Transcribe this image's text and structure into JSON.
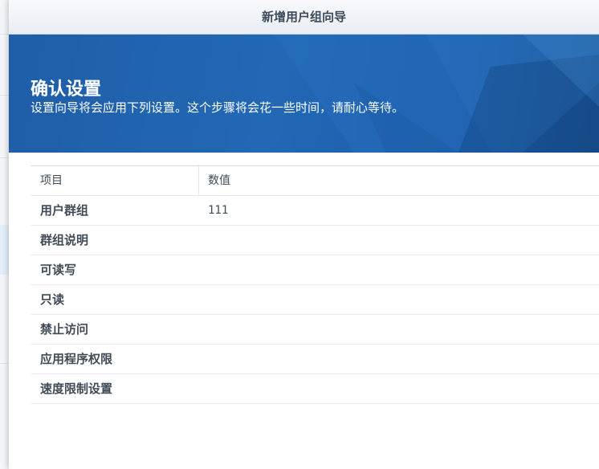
{
  "window": {
    "title": "新增用户组向导"
  },
  "banner": {
    "heading": "确认设置",
    "subtitle": "设置向导将会应用下列设置。这个步骤将会花一些时间，请耐心等待。"
  },
  "table": {
    "headers": {
      "item": "项目",
      "value": "数值"
    },
    "rows": [
      {
        "item": "用户群组",
        "value": "111"
      },
      {
        "item": "群组说明",
        "value": ""
      },
      {
        "item": "可读写",
        "value": ""
      },
      {
        "item": "只读",
        "value": ""
      },
      {
        "item": "禁止访问",
        "value": ""
      },
      {
        "item": "应用程序权限",
        "value": ""
      },
      {
        "item": "速度限制设置",
        "value": ""
      }
    ]
  },
  "colors": {
    "banner": "#2268b4",
    "titlebar": "#eef2f7",
    "text": "#414b55"
  }
}
